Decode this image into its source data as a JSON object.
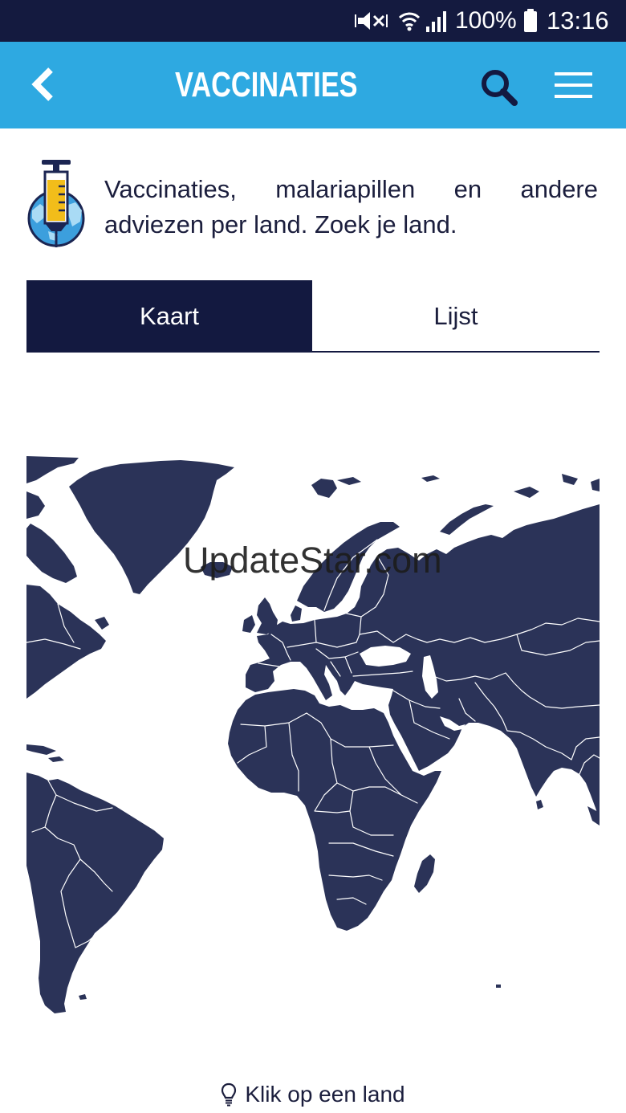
{
  "status_bar": {
    "battery": "100%",
    "time": "13:16",
    "icons": {
      "mute": "mute-icon",
      "wifi": "wifi-icon",
      "signal": "signal-icon",
      "battery": "battery-icon"
    }
  },
  "app_bar": {
    "title": "VACCINATIES",
    "icons": {
      "back": "chevron-left-icon",
      "search": "search-icon",
      "menu": "hamburger-menu-icon"
    }
  },
  "intro": {
    "icon": "syringe-globe-icon",
    "text": "Vaccinaties, malariapillen en andere adviezen per land. Zoek je land."
  },
  "tabs": [
    {
      "label": "Kaart",
      "selected": true
    },
    {
      "label": "Lijst",
      "selected": false
    }
  ],
  "map": {
    "icon": "world-map-icon"
  },
  "watermark": "UpdateStar.com",
  "hint": {
    "icon": "lightbulb-icon",
    "text": "Klik op een land"
  },
  "colors": {
    "status_bar": "#141a3f",
    "app_bar": "#2ea9e1",
    "accent_dark": "#131940",
    "map_land": "#2b3358",
    "text": "#1b1e3d",
    "syringe_liquid": "#f2bd1a"
  }
}
